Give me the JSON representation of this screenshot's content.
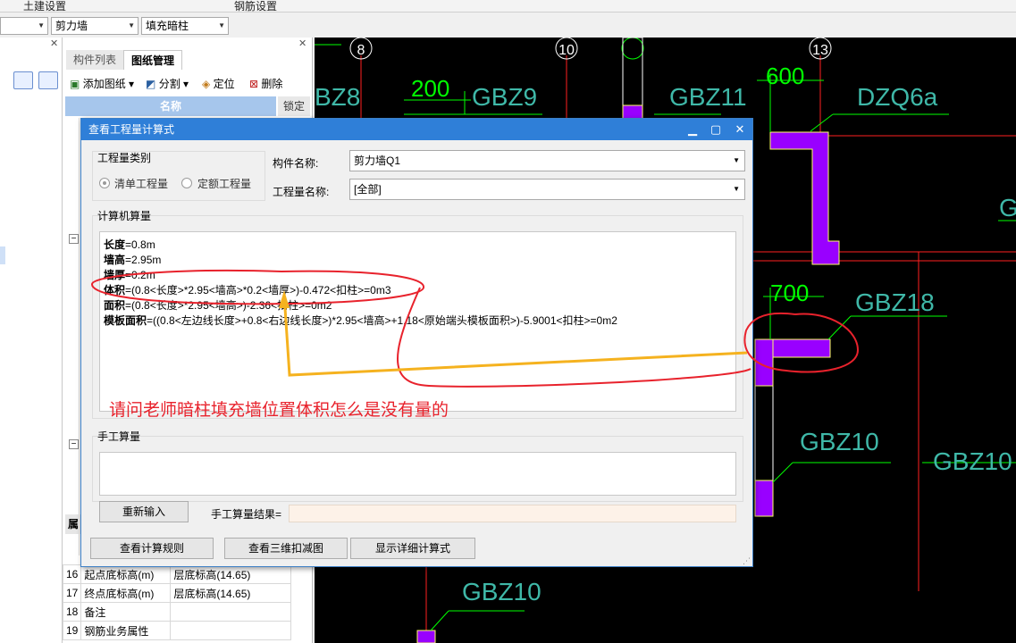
{
  "topbar": {
    "left_label": "土建设置",
    "right_label": "钢筋设置"
  },
  "combos": {
    "c1": "",
    "c2": "剪力墙",
    "c3": "填充暗柱"
  },
  "panel": {
    "tab1": "构件列表",
    "tab2": "图纸管理",
    "add_drawing": "添加图纸",
    "split": "分割",
    "locate": "定位",
    "delete": "删除",
    "col_name": "名称",
    "col_lock": "锁定"
  },
  "props": {
    "header_frag": "属",
    "rows": [
      {
        "no": "16",
        "name": "起点底标高(m)",
        "value": "层底标高(14.65)"
      },
      {
        "no": "17",
        "name": "终点底标高(m)",
        "value": "层底标高(14.65)"
      },
      {
        "no": "18",
        "name": "备注",
        "value": ""
      },
      {
        "no": "19",
        "name": "钢筋业务属性",
        "value": ""
      }
    ]
  },
  "dialog": {
    "title": "查看工程量计算式",
    "qty_type_label": "工程量类别",
    "radio_list": "清单工程量",
    "radio_quota": "定额工程量",
    "comp_name_label": "构件名称:",
    "comp_name_value": "剪力墙Q1",
    "qty_name_label": "工程量名称:",
    "qty_name_value": "[全部]",
    "computer_calc_label": "计算机算量",
    "lines": [
      {
        "key": "长度",
        "val": "=0.8m"
      },
      {
        "key": "墙高",
        "val": "=2.95m"
      },
      {
        "key": "墙厚",
        "val": "=0.2m"
      },
      {
        "key": "体积",
        "val": "=(0.8<长度>*2.95<墙高>*0.2<墙厚>)-0.472<扣柱>=0m3"
      },
      {
        "key": "面积",
        "val": "=(0.8<长度>*2.95<墙高>)-2.36<扣柱>=0m2"
      },
      {
        "key": "模板面积",
        "val": "=((0.8<左边线长度>+0.8<右边线长度>)*2.95<墙高>+1.18<原始端头模板面积>)-5.9001<扣柱>=0m2"
      }
    ],
    "manual_label": "手工算量",
    "reenter": "重新输入",
    "manual_result_label": "手工算量结果=",
    "btn_rules": "查看计算规则",
    "btn_3d": "查看三维扣减图",
    "btn_detail": "显示详细计算式"
  },
  "cad": {
    "axis": [
      "8",
      "10",
      "13"
    ],
    "labels": [
      "BZ8",
      "GBZ9",
      "GBZ11",
      "DZQ6a",
      "GBZ18",
      "GBZ10",
      "GBZ10",
      "GBZ10",
      "GI"
    ],
    "dims": [
      "200",
      "600",
      "700"
    ],
    "colors": {
      "wall": "#9900ff",
      "line": "#00ff00",
      "text": "#3fb8a8",
      "axis": "#ff2020"
    }
  },
  "annotation": {
    "question": "请问老师暗柱填充墙位置体积怎么是没有量的"
  }
}
